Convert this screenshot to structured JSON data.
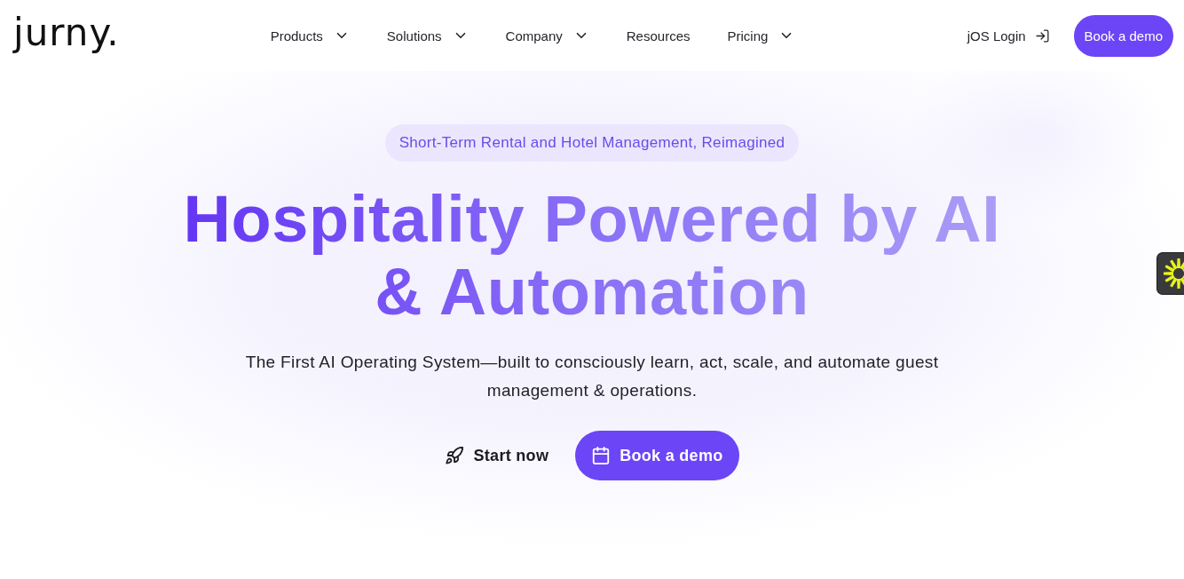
{
  "header": {
    "logo": "jurny.",
    "nav": [
      {
        "label": "Products",
        "dropdown": true
      },
      {
        "label": "Solutions",
        "dropdown": true
      },
      {
        "label": "Company",
        "dropdown": true
      },
      {
        "label": "Resources",
        "dropdown": false
      },
      {
        "label": "Pricing",
        "dropdown": true
      }
    ],
    "login": "jOS Login",
    "cta": "Book a demo"
  },
  "hero": {
    "tag": "Short-Term Rental and Hotel Management, Reimagined",
    "headline": "Hospitality Powered by AI & Automation",
    "subtitle": "The First AI Operating System—built to consciously learn, act, scale, and automate guest management & operations.",
    "actions": [
      {
        "kind": "link",
        "label": "Start now"
      },
      {
        "kind": "primary",
        "label": "Book a demo"
      }
    ]
  }
}
